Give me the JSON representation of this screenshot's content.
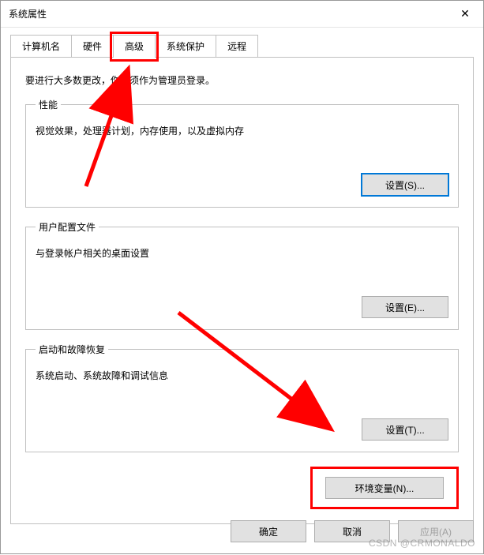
{
  "window": {
    "title": "系统属性",
    "close_glyph": "✕"
  },
  "tabs": {
    "computer_name": "计算机名",
    "hardware": "硬件",
    "advanced": "高级",
    "system_protection": "系统保护",
    "remote": "远程"
  },
  "pane": {
    "intro": "要进行大多数更改，你必须作为管理员登录。",
    "performance": {
      "title": "性能",
      "desc": "视觉效果，处理器计划，内存使用，以及虚拟内存",
      "settings_btn": "设置(S)..."
    },
    "user_profiles": {
      "title": "用户配置文件",
      "desc": "与登录帐户相关的桌面设置",
      "settings_btn": "设置(E)..."
    },
    "startup": {
      "title": "启动和故障恢复",
      "desc": "系统启动、系统故障和调试信息",
      "settings_btn": "设置(T)..."
    },
    "env_btn": "环境变量(N)..."
  },
  "buttons": {
    "ok": "确定",
    "cancel": "取消",
    "apply": "应用(A)"
  },
  "watermark": "CSDN @CRMONALDO"
}
